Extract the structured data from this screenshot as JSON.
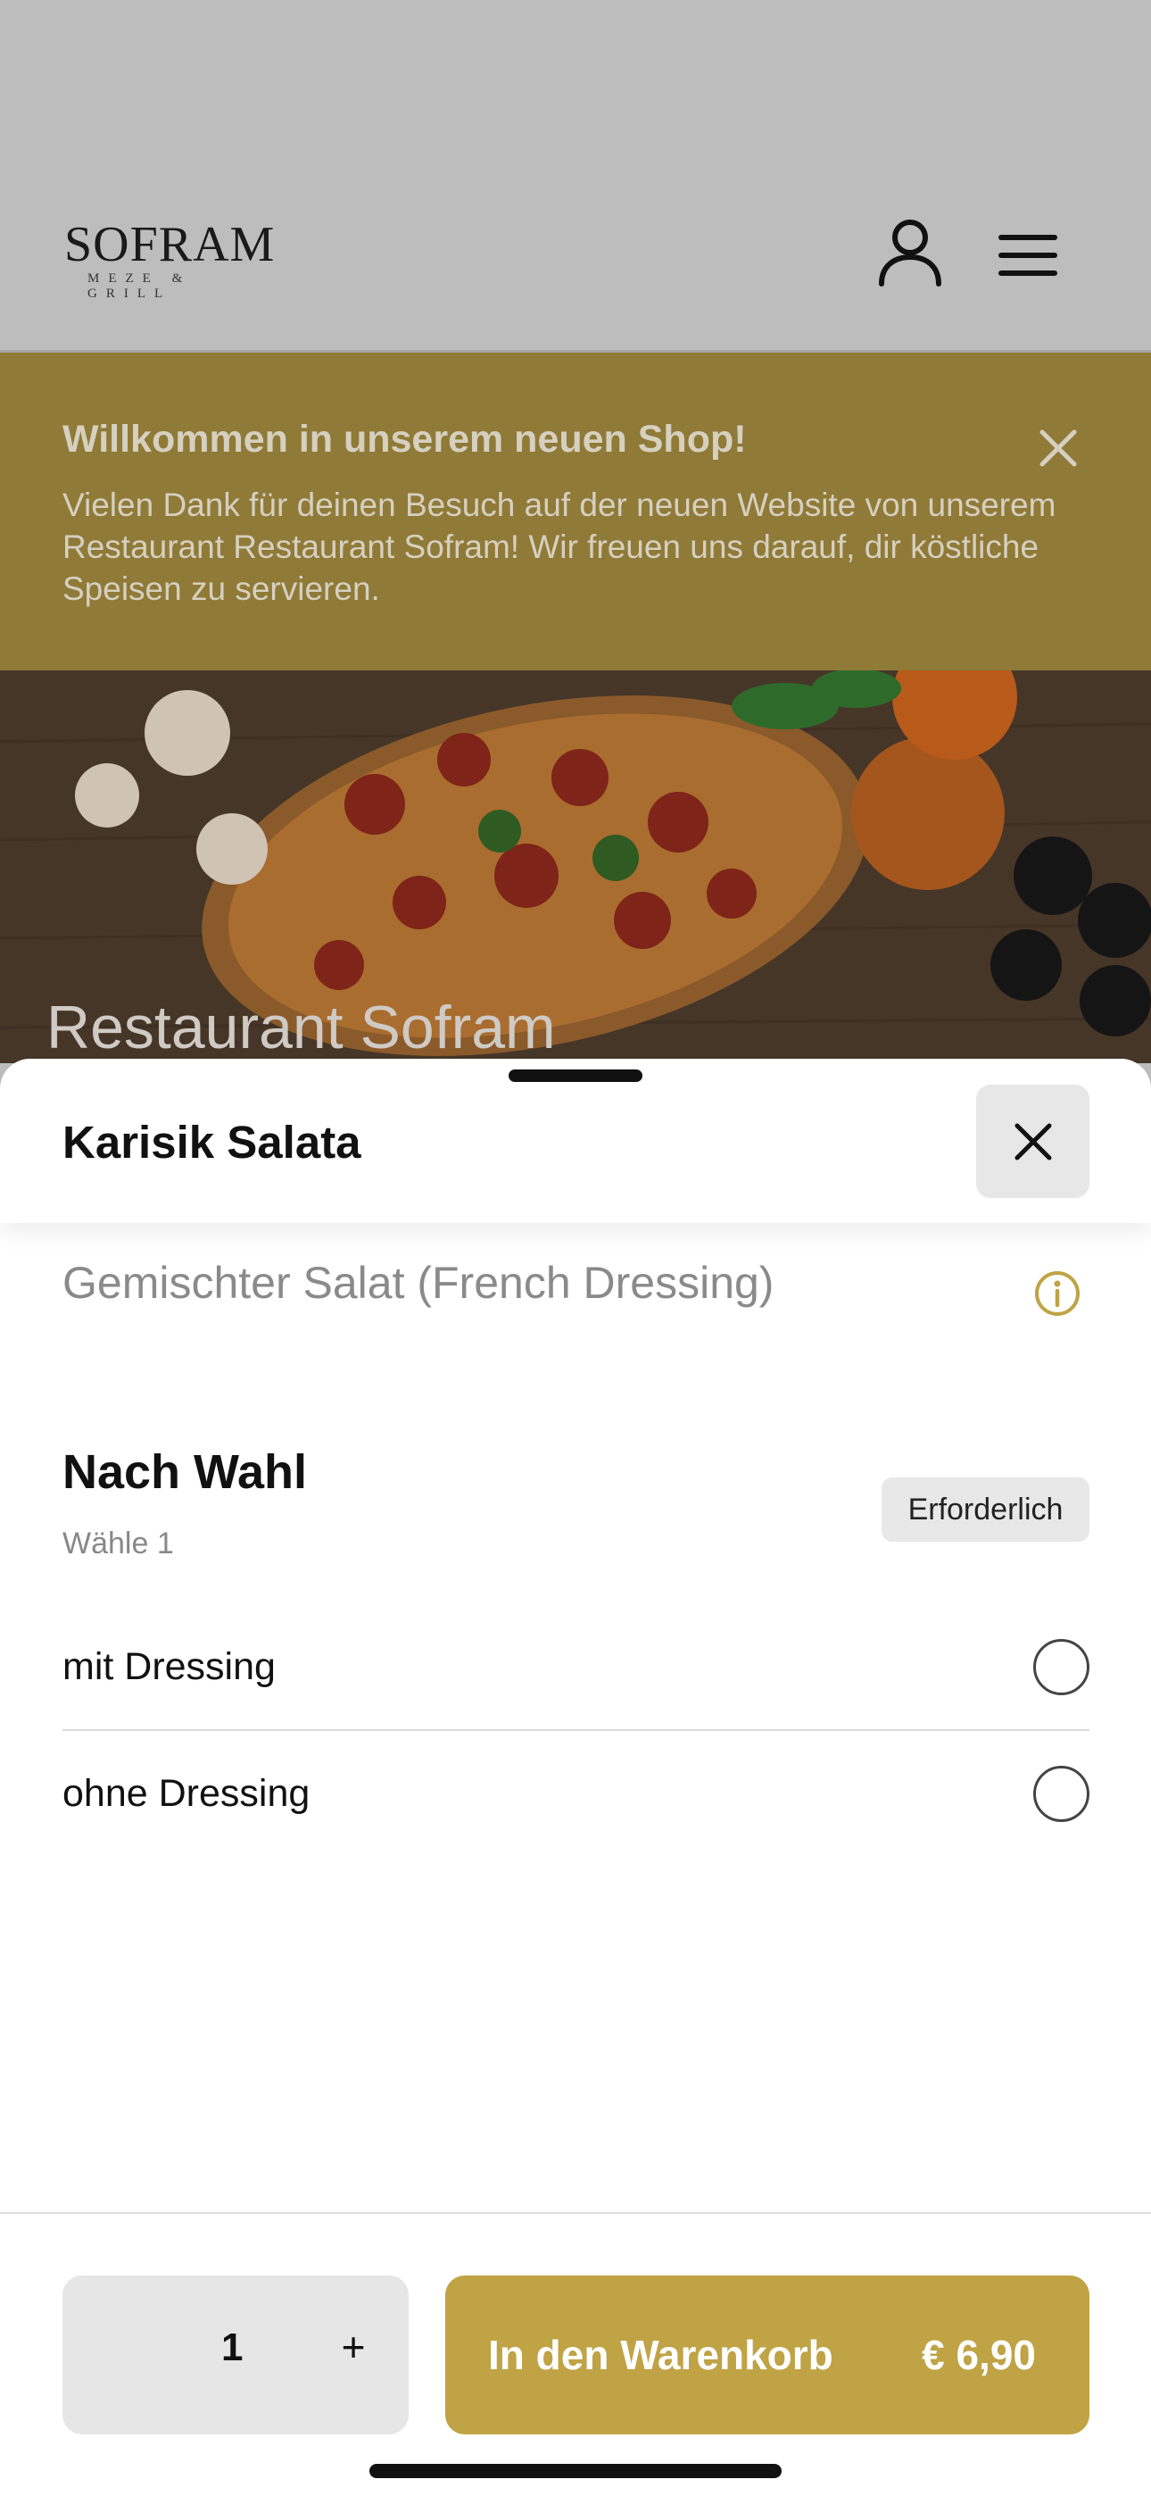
{
  "header": {
    "logo_text": "SOFRAM",
    "logo_tagline": "MEZE & GRILL",
    "icons": {
      "user": "user-icon",
      "menu": "hamburger-menu-icon"
    }
  },
  "banner": {
    "title": "Willkommen in unserem neuen Shop!",
    "text": "Vielen Dank für deinen Besuch auf der neuen Website von unserem Restaurant Restaurant Sofram! Wir freuen uns darauf, dir köstliche Speisen zu servieren.",
    "close_icon": "close-icon",
    "background": "#8f7a38"
  },
  "hero": {
    "title": "Restaurant Sofram"
  },
  "sheet": {
    "title": "Karisik Salata",
    "description": "Gemischter Salat (French Dressing)",
    "info_icon": "info-icon",
    "group": {
      "title": "Nach Wahl",
      "subtitle": "Wähle 1",
      "badge": "Erforderlich",
      "options": [
        {
          "label": "mit Dressing",
          "selected": false
        },
        {
          "label": "ohne Dressing",
          "selected": false
        }
      ]
    }
  },
  "footer": {
    "quantity": "1",
    "plus_label": "+",
    "cart_label": "In den Warenkorb",
    "price": "€ 6,90",
    "accent": "#bfa345"
  }
}
